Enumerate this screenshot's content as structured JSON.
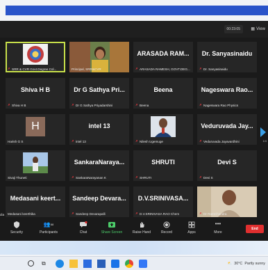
{
  "header": {
    "timer": "00:23:05",
    "view_label": "View"
  },
  "tiles": [
    {
      "big": "",
      "label": "SRR & CVR Govt.Degree Col...",
      "muted": true,
      "kind": "logo"
    },
    {
      "big": "",
      "label": "Principal, SRR&CVR",
      "muted": false,
      "kind": "photo-woman"
    },
    {
      "big": "ARASADA RAM...",
      "label": "ARASADA RAMESH, GOVT.DEG...",
      "muted": true,
      "kind": "text"
    },
    {
      "big": "Dr. Sanyasinaidu",
      "label": "Dr. Sanyasinaidu",
      "muted": true,
      "kind": "text"
    },
    {
      "big": "Shiva H B",
      "label": "Shiva H B",
      "muted": true,
      "kind": "text"
    },
    {
      "big": "Dr G Sathya Pri...",
      "label": "Dr G Sathya Priyadarshini",
      "muted": true,
      "kind": "text"
    },
    {
      "big": "Beena",
      "label": "Beena",
      "muted": true,
      "kind": "text"
    },
    {
      "big": "Nageswara Rao...",
      "label": "Nageswara Rao Physics",
      "muted": true,
      "kind": "text"
    },
    {
      "big": "H",
      "label": "Harish G S",
      "muted": false,
      "kind": "avatar"
    },
    {
      "big": "intel 13",
      "label": "intel 13",
      "muted": true,
      "kind": "text"
    },
    {
      "big": "",
      "label": "Nilesh Ugemuge",
      "muted": true,
      "kind": "photo-man"
    },
    {
      "big": "Veduruvada Jay...",
      "label": "Veduruvada Jayavardhini",
      "muted": true,
      "kind": "text"
    },
    {
      "big": "",
      "label": "Sivaji Thuneti",
      "muted": false,
      "kind": "photo-sky"
    },
    {
      "big": "SankaraNaraya...",
      "label": "SankaraNarayanan K",
      "muted": true,
      "kind": "text"
    },
    {
      "big": "SHRUTI",
      "label": "SHRUTI",
      "muted": true,
      "kind": "text"
    },
    {
      "big": "Devi S",
      "label": "Devi S",
      "muted": true,
      "kind": "text"
    },
    {
      "big": "Medasani keert...",
      "label": "Medasani keerthika",
      "muted": false,
      "kind": "text"
    },
    {
      "big": "Sandeep Devara...",
      "label": "Sandeep Devarapalli",
      "muted": true,
      "kind": "text"
    },
    {
      "big": "D.V.SRINIVASA...",
      "label": "D.V.SRINIVASA RAO Chem",
      "muted": true,
      "kind": "text"
    },
    {
      "big": "",
      "label": "Dr RamChandra",
      "muted": true,
      "kind": "photo-speaker"
    }
  ],
  "left_edge_fragment": "dia",
  "page_indicator": "1/4",
  "toolbar": {
    "security": "Security",
    "participants": "Participants",
    "participants_count": "88",
    "chat": "Chat",
    "share_screen": "Share Screen",
    "raise_hand": "Raise Hand",
    "record": "Record",
    "apps": "Apps",
    "more": "More",
    "end": "End"
  },
  "weather": {
    "temp": "30°C",
    "text": "Partly sunny"
  },
  "colors": {
    "accent_blue": "#2a54c9",
    "end_red": "#e02f2f",
    "share_green": "#4ccc6a",
    "active_border": "#c8e04a"
  }
}
